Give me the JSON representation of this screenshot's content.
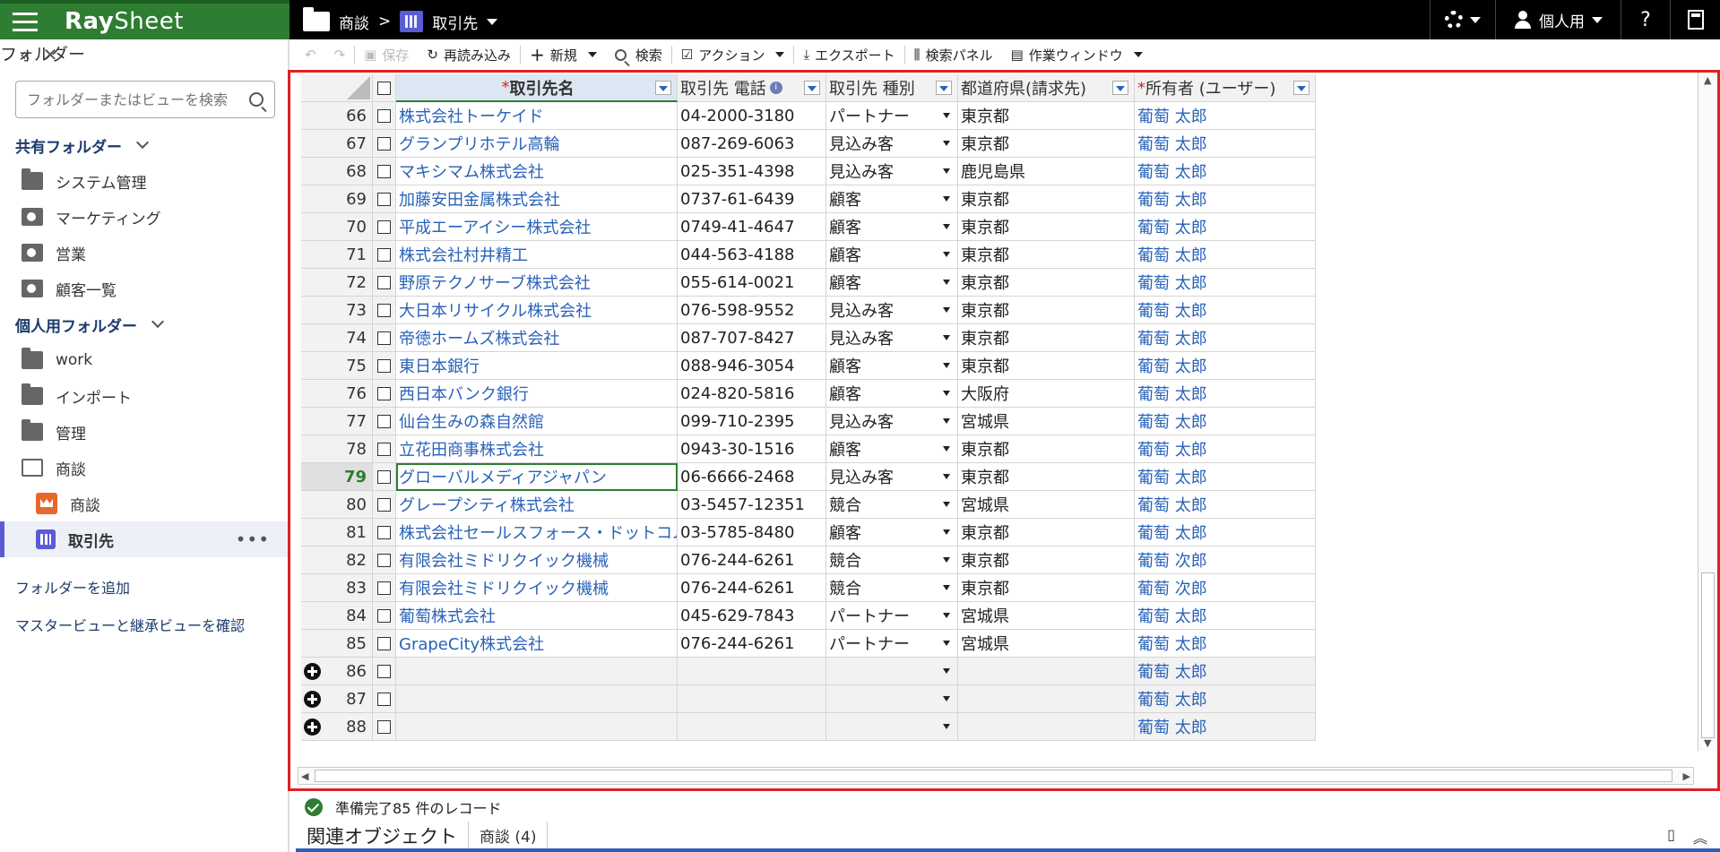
{
  "app": {
    "name_bold": "Ray",
    "name_thin": "Sheet"
  },
  "breadcrumb": {
    "parent": "商談",
    "separator": ">",
    "current": "取引先"
  },
  "header_right": {
    "user_label": "個人用",
    "help": "?"
  },
  "sidebar": {
    "title": "フォルダー",
    "search_placeholder": "フォルダーまたはビューを検索",
    "shared_section": "共有フォルダー",
    "shared_items": [
      "システム管理",
      "マーケティング",
      "営業",
      "顧客一覧"
    ],
    "personal_section": "個人用フォルダー",
    "personal_items": [
      "work",
      "インポート",
      "管理",
      "商談"
    ],
    "sub_items": [
      "商談",
      "取引先"
    ],
    "links": [
      "フォルダーを追加",
      "マスタービューと継承ビューを確認"
    ]
  },
  "toolbar": {
    "save": "保存",
    "reload": "再読み込み",
    "new": "新規",
    "search": "検索",
    "action": "アクション",
    "export": "エクスポート",
    "search_panel": "検索パネル",
    "work_window": "作業ウィンドウ"
  },
  "grid": {
    "columns": [
      "取引先名",
      "取引先 電話",
      "取引先 種別",
      "都道府県(請求先)",
      "所有者 (ユーザー)"
    ],
    "rows": [
      {
        "n": "66",
        "name": "株式会社トーケイド",
        "tel": "04-2000-3180",
        "type": "パートナー",
        "pref": "東京都",
        "owner": "葡萄 太郎"
      },
      {
        "n": "67",
        "name": "グランプリホテル高輪",
        "tel": "087-269-6063",
        "type": "見込み客",
        "pref": "東京都",
        "owner": "葡萄 太郎"
      },
      {
        "n": "68",
        "name": "マキシマム株式会社",
        "tel": "025-351-4398",
        "type": "見込み客",
        "pref": "鹿児島県",
        "owner": "葡萄 太郎"
      },
      {
        "n": "69",
        "name": "加藤安田金属株式会社",
        "tel": "0737-61-6439",
        "type": "顧客",
        "pref": "東京都",
        "owner": "葡萄 太郎"
      },
      {
        "n": "70",
        "name": "平成エーアイシー株式会社",
        "tel": "0749-41-4647",
        "type": "顧客",
        "pref": "東京都",
        "owner": "葡萄 太郎"
      },
      {
        "n": "71",
        "name": "株式会社村井精工",
        "tel": "044-563-4188",
        "type": "顧客",
        "pref": "東京都",
        "owner": "葡萄 太郎"
      },
      {
        "n": "72",
        "name": "野原テクノサーブ株式会社",
        "tel": "055-614-0021",
        "type": "顧客",
        "pref": "東京都",
        "owner": "葡萄 太郎"
      },
      {
        "n": "73",
        "name": "大日本リサイクル株式会社",
        "tel": "076-598-9552",
        "type": "見込み客",
        "pref": "東京都",
        "owner": "葡萄 太郎"
      },
      {
        "n": "74",
        "name": "帝徳ホームズ株式会社",
        "tel": "087-707-8427",
        "type": "見込み客",
        "pref": "東京都",
        "owner": "葡萄 太郎"
      },
      {
        "n": "75",
        "name": "東日本銀行",
        "tel": "088-946-3054",
        "type": "顧客",
        "pref": "東京都",
        "owner": "葡萄 太郎"
      },
      {
        "n": "76",
        "name": "西日本バンク銀行",
        "tel": "024-820-5816",
        "type": "顧客",
        "pref": "大阪府",
        "owner": "葡萄 太郎"
      },
      {
        "n": "77",
        "name": "仙台生みの森自然館",
        "tel": "099-710-2395",
        "type": "見込み客",
        "pref": "宮城県",
        "owner": "葡萄 太郎"
      },
      {
        "n": "78",
        "name": "立花田商事株式会社",
        "tel": "0943-30-1516",
        "type": "顧客",
        "pref": "東京都",
        "owner": "葡萄 太郎"
      },
      {
        "n": "79",
        "name": "グローバルメディアジャパン",
        "tel": "06-6666-2468",
        "type": "見込み客",
        "pref": "東京都",
        "owner": "葡萄 太郎"
      },
      {
        "n": "80",
        "name": "グレープシティ株式会社",
        "tel": "03-5457-12351",
        "type": "競合",
        "pref": "宮城県",
        "owner": "葡萄 太郎"
      },
      {
        "n": "81",
        "name": "株式会社セールスフォース・ドットコム",
        "tel": "03-5785-8480",
        "type": "顧客",
        "pref": "東京都",
        "owner": "葡萄 太郎"
      },
      {
        "n": "82",
        "name": "有限会社ミドリクイック機械",
        "tel": "076-244-6261",
        "type": "競合",
        "pref": "東京都",
        "owner": "葡萄 次郎"
      },
      {
        "n": "83",
        "name": "有限会社ミドリクイック機械",
        "tel": "076-244-6261",
        "type": "競合",
        "pref": "東京都",
        "owner": "葡萄 次郎"
      },
      {
        "n": "84",
        "name": "葡萄株式会社",
        "tel": "045-629-7843",
        "type": "パートナー",
        "pref": "宮城県",
        "owner": "葡萄 太郎"
      },
      {
        "n": "85",
        "name": "GrapeCity株式会社",
        "tel": "076-244-6261",
        "type": "パートナー",
        "pref": "宮城県",
        "owner": "葡萄 太郎"
      },
      {
        "n": "86",
        "name": "",
        "tel": "",
        "type": "",
        "pref": "",
        "owner": "葡萄 太郎",
        "new": true
      },
      {
        "n": "87",
        "name": "",
        "tel": "",
        "type": "",
        "pref": "",
        "owner": "葡萄 太郎",
        "new": true
      },
      {
        "n": "88",
        "name": "",
        "tel": "",
        "type": "",
        "pref": "",
        "owner": "葡萄 太郎",
        "new": true
      }
    ],
    "selected_row": "79"
  },
  "status": {
    "text": "準備完了",
    "count": "85 件のレコード"
  },
  "related": {
    "title": "関連オブジェクト",
    "tab": "商談 (4)"
  },
  "colors": {
    "brand_green": "#2e7d32",
    "link_blue": "#2a62b8",
    "frame_red": "#e02020",
    "view_purple": "#5b5bd6"
  }
}
